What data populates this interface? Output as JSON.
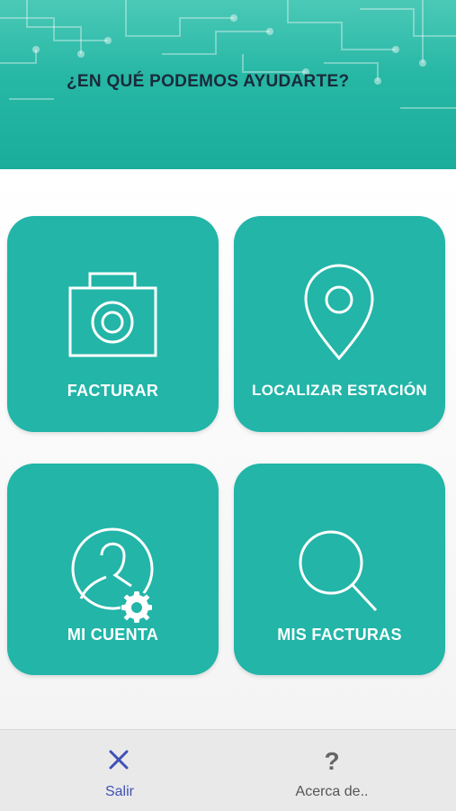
{
  "header": {
    "title": "¿EN QUÉ PODEMOS AYUDARTE?"
  },
  "menu": {
    "items": [
      {
        "label": "FACTURAR",
        "icon": "camera-icon"
      },
      {
        "label": "LOCALIZAR ESTACIÓN",
        "icon": "location-pin-icon"
      },
      {
        "label": "MI CUENTA",
        "icon": "user-settings-icon"
      },
      {
        "label": "MIS FACTURAS",
        "icon": "search-icon"
      }
    ]
  },
  "bottom_nav": {
    "exit_label": "Salir",
    "exit_icon": "close-icon",
    "about_label": "Acerca de..",
    "about_icon": "question-icon"
  },
  "colors": {
    "header": "#27b7a5",
    "tile": "#22b5a8",
    "title_text": "#1a2a3a",
    "exit_accent": "#3f51b5",
    "about_text": "#555555"
  }
}
